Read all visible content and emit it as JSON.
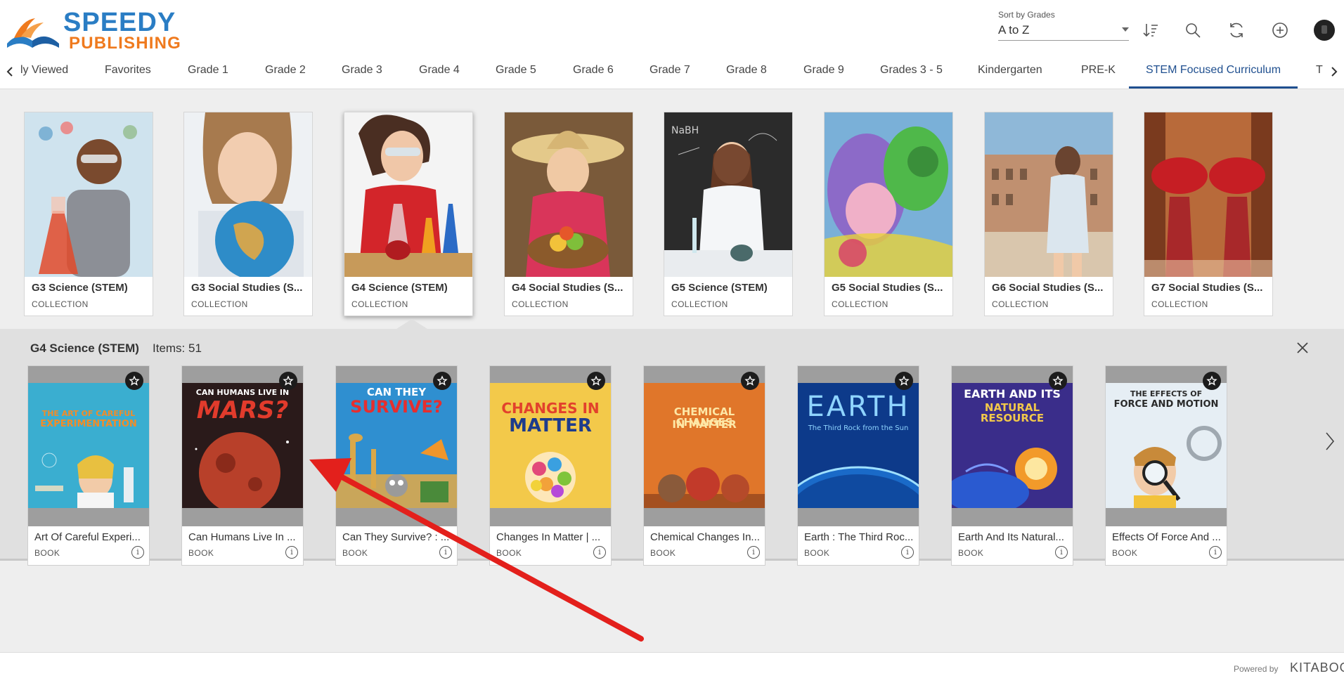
{
  "brand": {
    "line1": "SPEEDY",
    "line2": "PUBLISHING"
  },
  "sort": {
    "label": "Sort by Grades",
    "value": "A to Z"
  },
  "header_icons": [
    "sort-order-icon",
    "search-icon",
    "refresh-icon",
    "add-icon",
    "user-avatar"
  ],
  "tabs": [
    {
      "label": "ly Viewed"
    },
    {
      "label": "Favorites"
    },
    {
      "label": "Grade 1"
    },
    {
      "label": "Grade 2"
    },
    {
      "label": "Grade 3"
    },
    {
      "label": "Grade 4"
    },
    {
      "label": "Grade 5"
    },
    {
      "label": "Grade 6"
    },
    {
      "label": "Grade 7"
    },
    {
      "label": "Grade 8"
    },
    {
      "label": "Grade 9"
    },
    {
      "label": "Grades 3 - 5"
    },
    {
      "label": "Kindergarten"
    },
    {
      "label": "PRE-K"
    },
    {
      "label": "STEM Focused Curriculum",
      "active": true
    },
    {
      "label": "T"
    }
  ],
  "collections": [
    {
      "title": "G3 Science (STEM)",
      "type": "COLLECTION"
    },
    {
      "title": "G3 Social Studies (S...",
      "type": "COLLECTION"
    },
    {
      "title": "G4 Science (STEM)",
      "type": "COLLECTION",
      "selected": true
    },
    {
      "title": "G4 Social Studies (S...",
      "type": "COLLECTION"
    },
    {
      "title": "G5 Science (STEM)",
      "type": "COLLECTION"
    },
    {
      "title": "G5 Social Studies (S...",
      "type": "COLLECTION"
    },
    {
      "title": "G6 Social Studies (S...",
      "type": "COLLECTION"
    },
    {
      "title": "G7 Social Studies (S...",
      "type": "COLLECTION"
    }
  ],
  "panel": {
    "title": "G4 Science (STEM)",
    "items": "Items: 51"
  },
  "books": [
    {
      "title": "Art Of Careful Experi...",
      "type": "BOOK",
      "cover": {
        "line1": "THE ART OF CAREFUL",
        "line2": "EXPERIMENTATION",
        "bg": "#3aaed0",
        "fg": "#f28c28"
      }
    },
    {
      "title": "Can Humans Live In ...",
      "type": "BOOK",
      "cover": {
        "line1": "CAN HUMANS LIVE IN",
        "line2": "MARS?",
        "bg": "#2a1a1a",
        "fg": "#e23b2c"
      }
    },
    {
      "title": "Can They Survive? : ...",
      "type": "BOOK",
      "cover": {
        "line1": "CAN THEY",
        "line2": "SURVIVE?",
        "bg": "#2f8fd0",
        "fg": "#e62e2e"
      }
    },
    {
      "title": "Changes In Matter | ...",
      "type": "BOOK",
      "cover": {
        "line1": "CHANGES IN",
        "line2": "MATTER",
        "bg": "#f3c94a",
        "fg": "#1e3c8c"
      }
    },
    {
      "title": "Chemical Changes In...",
      "type": "BOOK",
      "cover": {
        "line1": "CHEMICAL CHANGES",
        "line2": "IN MATTER",
        "bg": "#e0762a",
        "fg": "#fde7a6"
      }
    },
    {
      "title": "Earth : The Third Roc...",
      "type": "BOOK",
      "cover": {
        "line1": "EARTH",
        "line2": "The Third Rock from the Sun",
        "bg": "#0d3a8a",
        "fg": "#8fd4ff"
      }
    },
    {
      "title": "Earth And Its Natural...",
      "type": "BOOK",
      "cover": {
        "line1": "EARTH AND ITS",
        "line2": "NATURAL RESOURCE",
        "bg": "#3a2d8a",
        "fg": "#ffffff"
      }
    },
    {
      "title": "Effects Of Force And ...",
      "type": "BOOK",
      "cover": {
        "line1": "THE EFFECTS OF",
        "line2": "FORCE AND MOTION",
        "bg": "#e6eef4",
        "fg": "#2a2a2a"
      }
    }
  ],
  "footer": {
    "powered": "Powered by",
    "brand": "KITABOO"
  }
}
